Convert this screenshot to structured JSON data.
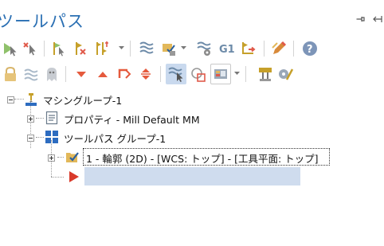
{
  "panel": {
    "title": "ツールパス",
    "pin_icon": "pin-icon",
    "dock_icon": "dock-icon"
  },
  "toolbar_row1": [
    {
      "name": "select-all-ops-button",
      "icon": "arrow-select-icon"
    },
    {
      "name": "deselect-button",
      "icon": "arrow-x-icon"
    },
    {
      "name": "select-failed-button",
      "icon": "arrow-flag-icon"
    },
    {
      "name": "delete-button",
      "icon": "flag-x-icon"
    },
    {
      "name": "sort-button",
      "icon": "sort-dropdown-icon"
    },
    {
      "name": "regen-all-button",
      "icon": "wave-layers-icon"
    },
    {
      "name": "regen-dirty-button",
      "icon": "check-folder-icon"
    },
    {
      "name": "regen-selected-button",
      "icon": "wave-gear-icon"
    },
    {
      "name": "g1-button",
      "icon": "g1-icon",
      "label": "G1"
    },
    {
      "name": "post-button",
      "icon": "post-arrow-icon"
    },
    {
      "name": "edit-button",
      "icon": "pencil-icon"
    },
    {
      "name": "help-button",
      "icon": "help-icon"
    }
  ],
  "toolbar_row2": [
    {
      "name": "lock-button",
      "icon": "lock-icon"
    },
    {
      "name": "wave-toggle-button",
      "icon": "wave-icon"
    },
    {
      "name": "ghost-button",
      "icon": "ghost-icon"
    },
    {
      "name": "move-down-button",
      "icon": "triangle-down-icon"
    },
    {
      "name": "move-up-button",
      "icon": "triangle-up-icon"
    },
    {
      "name": "insert-arrow-button",
      "icon": "insert-arrow-icon"
    },
    {
      "name": "expand-collapse-button",
      "icon": "updown-icon"
    },
    {
      "name": "show-selected-button",
      "icon": "wave-cursor-icon"
    },
    {
      "name": "shape-button",
      "icon": "shape-icon"
    },
    {
      "name": "display-options-button",
      "icon": "display-dropdown-icon"
    },
    {
      "name": "verify-button",
      "icon": "verify-icon"
    },
    {
      "name": "backplot-button",
      "icon": "backplot-icon"
    }
  ],
  "colors": {
    "title": "#2a6fb3",
    "selection": "#cfdcee",
    "arrow_red": "#d93a2b",
    "machine_blue": "#2d6cc0"
  },
  "tree": {
    "machine_group": "マシングループ-1",
    "properties": "プロパティ - Mill Default MM",
    "toolpath_group": "ツールパス グループ-1",
    "operation": "1 - 輪郭 (2D) - [WCS: トップ] - [工具平面: トップ]",
    "insert_arrow_icon": "insert-arrow-icon"
  }
}
